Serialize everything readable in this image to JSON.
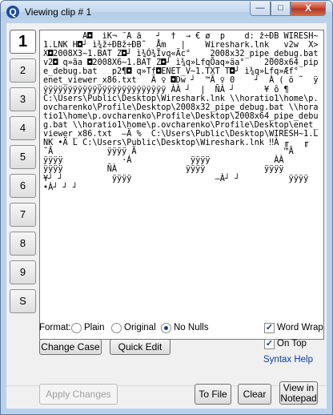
{
  "window": {
    "title": "Viewing clip # 1",
    "icon_letter": "Q",
    "controls": {
      "minimize": "—",
      "maximize": "□",
      "close": "X"
    }
  },
  "clip_buttons": [
    "1",
    "2",
    "3",
    "4",
    "5",
    "6",
    "7",
    "8",
    "9",
    "S"
  ],
  "active_clip": "1",
  "clip_content": "        À◘  ìK¬ ˜Â â   ┘  †  → € ø  p    d: ž÷ÐB WIRESH~1.LNK H◘┘ ì¾ž÷ÐBž÷ÐB˜  Åm   |    Wireshark.lnk   v2w  X>X◘2008X3~1.BAT Z◘┘ ì¾Ó¾Ïvq«Ãc°    2008x32_pipe_debug.bat   v2◘ q»ãa ◘2008X6~1.BAT Z◘┘ ì¾q»LfqÕaq»äa°    2008x64_pipe_debug.bat   p2¶◘ q»Tf◘ENET_V~1.TXT T◘┘ ì¾q»Lfq»Æf°      enet_viewer_x86.txt   Ä ♀ ◘Dw ┘  ™Â ♀ 0    ┘  À ( ö ˜  ÿÿÿÿÿÿÿÿÿÿÿÿÿÿÿÿÿÿÿÿÿÿÿÿÿÿ ÀÀ ┘  |  ÑÀ ┘      ¥ ô ¶      C:\\Users\\Public\\Desktop\\Wireshark.lnk \\\\horatio1\\home\\p.ovcharenko\\Profile\\Desktop\\2008x32_pipe_debug.bat \\\\horatio1\\home\\p.ovcharenko\\Profile\\Desktop\\2008x64_pipe_debug.bat \\\\horatio1\\home\\p.ovcharenko\\Profile\\Desktop\\enet_viewer_x86.txt  –Ä %  C:\\Users\\Public\\Desktop\\WIRESH~1.LNK •Ä L C:\\Users\\Public\\Desktop\\Wireshark.lnk ‼À ╓   ╓         ˜Â           ÿÿÿÿ Ä                              ™Â          ÿÿÿÿ            ·Á            ÿÿÿÿ             ÀÀ           ÿÿÿÿ         ÑÀ              ÿÿÿÿ            ÿÿÿÿ                                 ¥┘ ┘          ÿÿÿÿ                 –À┘ ┘          ÿÿÿÿ     •À┘ ┘ ┘",
  "format": {
    "label": "Format:",
    "options": [
      "Plain",
      "Original",
      "No Nulls"
    ],
    "selected": "No Nulls"
  },
  "options": {
    "word_wrap": {
      "label": "Word Wrap",
      "checked": true
    },
    "on_top": {
      "label": "On Top",
      "checked": true
    },
    "syntax_help": "Syntax Help"
  },
  "buttons": {
    "change_case": "Change Case",
    "quick_edit": "Quick Edit",
    "apply_changes": "Apply Changes",
    "to_file": "To File",
    "clear": "Clear",
    "view_in_notepad_line1": "View in",
    "view_in_notepad_line2": "Notepad"
  },
  "colors": {
    "accent_link": "#0b3ea8",
    "window_frame": "#b9d1ea"
  }
}
